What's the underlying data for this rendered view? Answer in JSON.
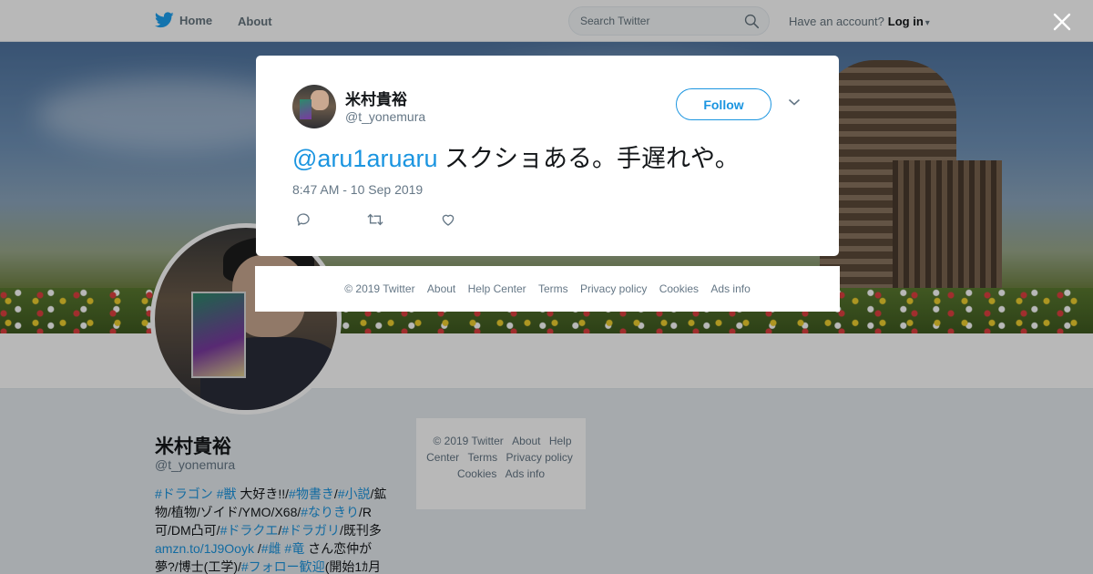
{
  "nav": {
    "home_label": "Home",
    "about_label": "About",
    "search_placeholder": "Search Twitter",
    "account_prompt": "Have an account?",
    "login_label": "Log in"
  },
  "profile": {
    "name": "米村貴裕",
    "handle": "@t_yonemura",
    "bio": [
      {
        "t": "#ドラゴン",
        "link": true
      },
      {
        "t": " ",
        "link": false
      },
      {
        "t": "#獣",
        "link": true
      },
      {
        "t": " 大好き!!/",
        "link": false
      },
      {
        "t": "#物書き",
        "link": true
      },
      {
        "t": "/",
        "link": false
      },
      {
        "t": "#小説",
        "link": true
      },
      {
        "t": "/鉱物/植物/ゾイド/YMO/X68/",
        "link": false
      },
      {
        "t": "#なりきり",
        "link": true
      },
      {
        "t": "/R可/DM凸可/",
        "link": false
      },
      {
        "t": "#ドラクエ",
        "link": true
      },
      {
        "t": "/",
        "link": false
      },
      {
        "t": "#ドラガリ",
        "link": true
      },
      {
        "t": "/既刊多 ",
        "link": false
      },
      {
        "t": "amzn.to/1J9Ooyk",
        "link": true
      },
      {
        "t": " /",
        "link": false
      },
      {
        "t": "#雌",
        "link": true
      },
      {
        "t": " ",
        "link": false
      },
      {
        "t": "#竜",
        "link": true
      },
      {
        "t": " さん恋仲が夢?/博士(工学)/",
        "link": false
      },
      {
        "t": "#フォロー歓迎",
        "link": true
      },
      {
        "t": "(開始1ｶ月",
        "link": false
      }
    ]
  },
  "side_footer": {
    "items": [
      "© 2019 Twitter",
      "About",
      "Help Center",
      "Terms",
      "Privacy policy",
      "Cookies",
      "Ads info"
    ]
  },
  "tweet": {
    "author_name": "米村貴裕",
    "author_handle": "@t_yonemura",
    "follow_label": "Follow",
    "mention": "@aru1aruaru",
    "text": " スクショある。手遅れや。",
    "timestamp": "8:47 AM - 10 Sep 2019"
  },
  "modal_footer": {
    "items": [
      "© 2019 Twitter",
      "About",
      "Help Center",
      "Terms",
      "Privacy policy",
      "Cookies",
      "Ads info"
    ]
  },
  "icons": {
    "brand": "twitter-bird-icon",
    "search": "search-icon",
    "close": "close-icon",
    "reply": "reply-icon",
    "retweet": "retweet-icon",
    "like": "heart-icon",
    "menu": "chevron-down-icon"
  },
  "colors": {
    "accent": "#1b95e0",
    "brand": "#1da1f2",
    "text": "#14171a",
    "muted": "#657786",
    "page_bg": "#e6ecf0"
  }
}
